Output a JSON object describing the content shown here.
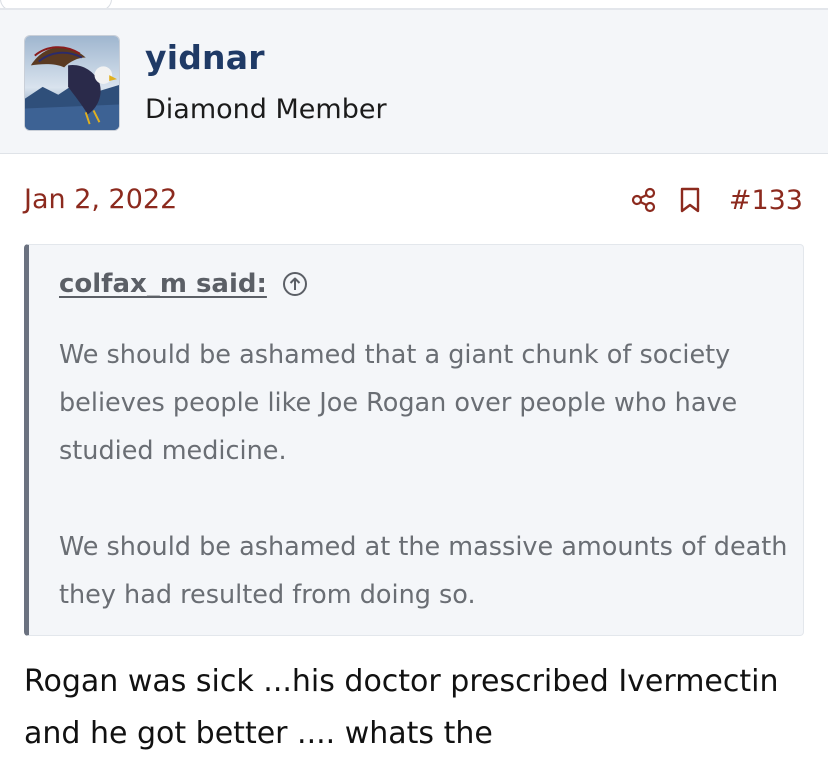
{
  "user": {
    "name": "yidnar",
    "title": "Diamond Member"
  },
  "post": {
    "date": "Jan 2, 2022",
    "number": "#133",
    "share_icon": "share-icon",
    "bookmark_icon": "bookmark-icon"
  },
  "quote": {
    "author": "colfax_m said:",
    "jump_icon": "arrow-up-circle-icon",
    "paragraphs": [
      "We should be ashamed that a giant chunk of society believes people like Joe Rogan over people who have studied medicine.",
      "We should be ashamed at the massive amounts of death they had resulted from doing so."
    ]
  },
  "reply": {
    "text": "Rogan was sick ...his doctor prescribed Ivermectin and he got better .... whats the"
  },
  "colors": {
    "username": "#1f3a66",
    "accent": "#8c2a1e",
    "quote_bg": "#f4f6f9",
    "quote_border": "#6b7280",
    "quote_text": "#6a6e74"
  }
}
